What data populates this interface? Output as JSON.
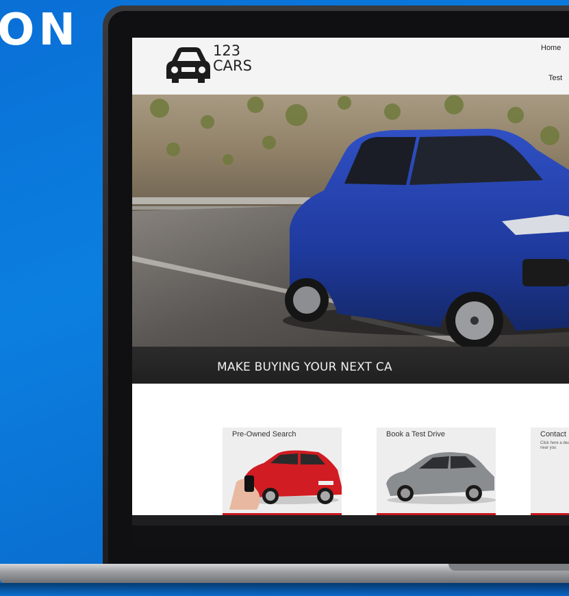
{
  "banner": {
    "title": "ON"
  },
  "site": {
    "logo": {
      "line1": "123",
      "line2": "CARS"
    },
    "nav": {
      "home": "Home",
      "test": "Test"
    },
    "hero": {
      "tagline": "MAKE BUYING YOUR NEXT CA"
    },
    "cards": [
      {
        "title": "Pre-Owned Search",
        "body": ""
      },
      {
        "title": "Book a Test Drive",
        "body": ""
      },
      {
        "title": "Contact",
        "body": "Click here a dealersh near you"
      }
    ]
  },
  "colors": {
    "background": "#0b7fe0",
    "accent_red": "#c8161d",
    "car_blue": "#1f3fa6",
    "card_car_red": "#d01c22",
    "card_car_grey": "#8a8d90"
  }
}
